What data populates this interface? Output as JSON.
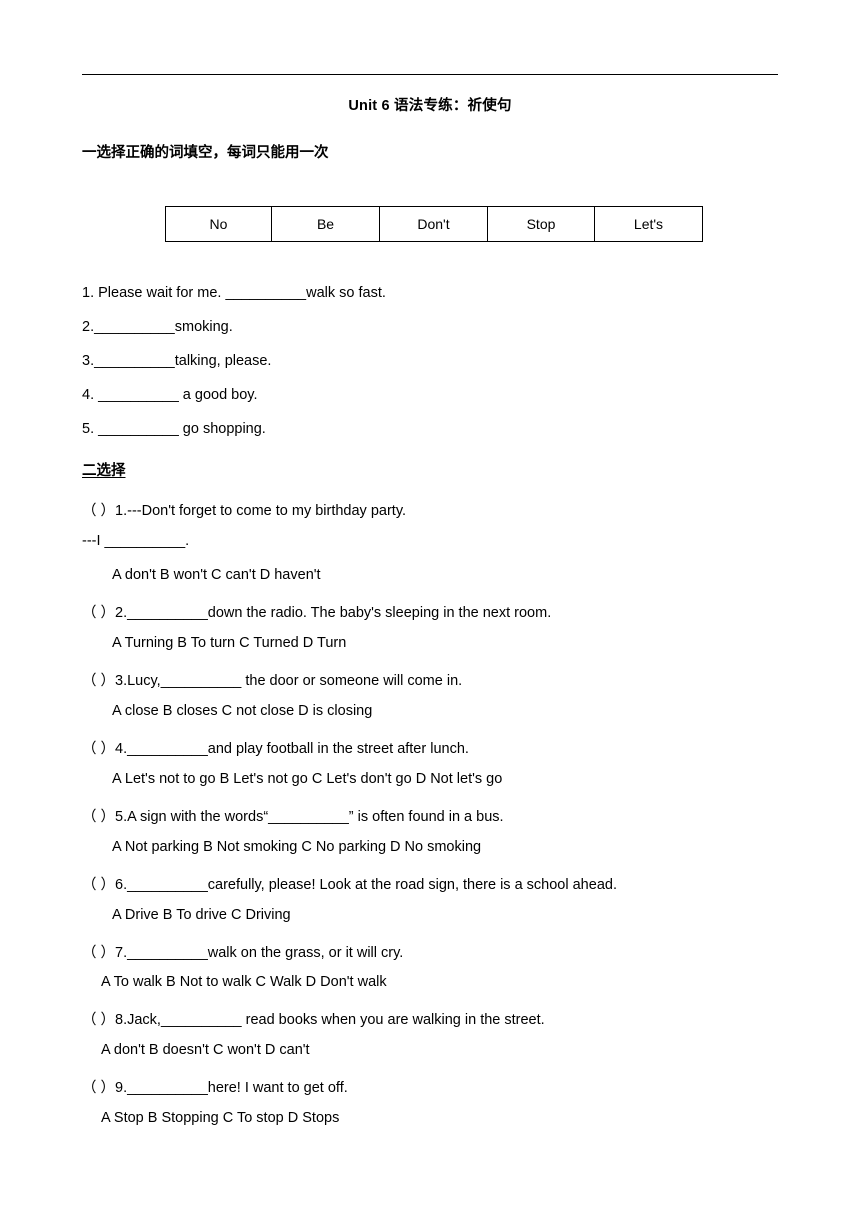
{
  "document": {
    "title": "Unit 6 语法专练：祈使句",
    "section_one_heading": "一选择正确的词填空，每词只能用一次",
    "section_two_heading": "二选择",
    "word_bank": [
      "No",
      "Be",
      "Don't",
      "Stop",
      "Let's"
    ],
    "fill_in_blanks": [
      "1. Please wait for me. __________walk so fast.",
      "2.__________smoking.",
      "3.__________talking, please.",
      "4. __________ a good boy.",
      "5. __________ go shopping."
    ],
    "multiple_choice": [
      {
        "stem": "（  ）1.---Don't forget to come to my birthday party.",
        "stem2": "---I __________.",
        "options": "A don't        B won't        C can't        D haven't"
      },
      {
        "stem": "（  ）2.__________down the radio. The baby's sleeping in the next room.",
        "options": "A Turning        B To turn     C Turned      D Turn"
      },
      {
        "stem": "（  ）3.Lucy,__________ the door or someone will come in.",
        "options": "A close        B closes        C not close      D is closing"
      },
      {
        "stem": "（  ）4.__________and play football in the street after lunch.",
        "options": "A Let's not to go      B Let's not go     C Let's don't go     D Not let's go"
      },
      {
        "stem": "（  ）5.A sign with the words“__________” is often found in a bus.",
        "options": "A Not parking        B Not smoking      C No parking      D No smoking"
      },
      {
        "stem": "（  ）6.__________carefully, please! Look at the road sign, there is a school ahead.",
        "options": "A Drive        B To drive        C Driving"
      },
      {
        "stem": "（  ）7.__________walk on the grass, or it will cry.",
        "options": "A To walk    B Not to walk    C Walk     D Don't walk"
      },
      {
        "stem": "（  ）8.Jack,__________ read books when you are walking in the street.",
        "options": "A don't      B doesn't      C won't      D can't"
      },
      {
        "stem": "（  ）9.__________here! I want to get off.",
        "options": "A Stop    B Stopping      C To stop    D Stops"
      }
    ]
  }
}
